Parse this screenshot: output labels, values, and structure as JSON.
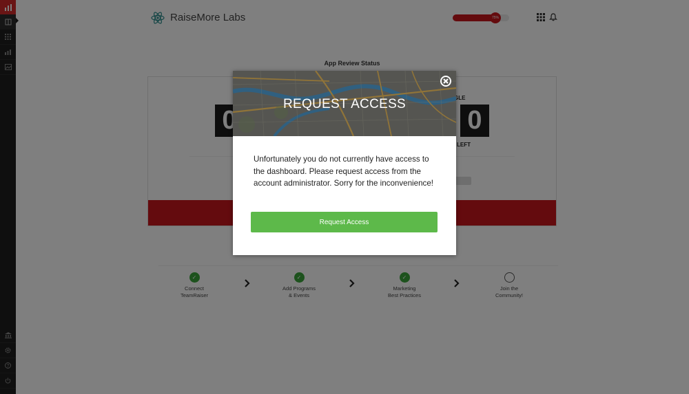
{
  "header": {
    "brand": "RaiseMore Labs",
    "progress": {
      "percent": 0.75,
      "label": "75%"
    }
  },
  "sidebar": {
    "items": [
      {
        "icon": "bar-chart-icon"
      },
      {
        "icon": "book-icon"
      },
      {
        "icon": "grid-icon"
      },
      {
        "icon": "stats-icon"
      },
      {
        "icon": "image-icon"
      }
    ],
    "bottom_items": [
      {
        "icon": "bank-icon"
      },
      {
        "icon": "gear-icon"
      },
      {
        "icon": "help-icon"
      },
      {
        "icon": "power-icon"
      }
    ]
  },
  "main": {
    "section_title": "App Review Status",
    "counter_left": "0",
    "counter_right": "0",
    "label_right_top": "GLE",
    "label_right_bottom": "LEFT",
    "steps": [
      {
        "label_line1": "Connect",
        "label_line2": "TeamRaiser",
        "done": true
      },
      {
        "label_line1": "Add Programs",
        "label_line2": "& Events",
        "done": true
      },
      {
        "label_line1": "Marketing",
        "label_line2": "Best Practices",
        "done": true
      },
      {
        "label_line1": "Join the",
        "label_line2": "Community!",
        "done": false
      }
    ]
  },
  "modal": {
    "title": "REQUEST ACCESS",
    "body": "Unfortunately you do not currently have access to the dashboard. Please request access from the account administrator. Sorry for the inconvenience!",
    "button": "Request Access"
  },
  "colors": {
    "brand_red": "#c8161d",
    "success_green": "#5db94a",
    "step_green": "#3aa53a"
  }
}
